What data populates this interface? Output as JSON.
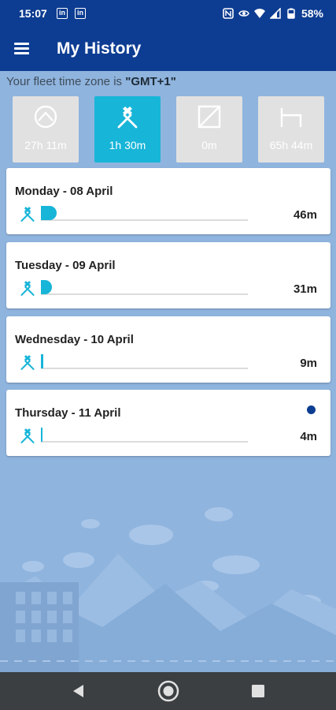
{
  "status_bar": {
    "time": "15:07",
    "left_icons": [
      "in",
      "in"
    ],
    "battery": "58%",
    "icons": [
      "nfc-icon",
      "eye-icon",
      "wifi-icon",
      "signal-icon",
      "battery-icon"
    ]
  },
  "app_bar": {
    "title": "My History",
    "menu_icon": "menu-icon"
  },
  "timezone": {
    "prefix": "Your fleet time zone is ",
    "value": "\"GMT+1\""
  },
  "summary": [
    {
      "icon": "steering-wheel-icon",
      "value": "27h 11m",
      "active": false
    },
    {
      "icon": "work-tools-icon",
      "value": "1h 30m",
      "active": true
    },
    {
      "icon": "availability-icon",
      "value": "0m",
      "active": false
    },
    {
      "icon": "bed-rest-icon",
      "value": "65h 44m",
      "active": false
    }
  ],
  "days": [
    {
      "title": "Monday - 08 April",
      "total": "46m",
      "fraction": 0.077,
      "current": false
    },
    {
      "title": "Tuesday - 09 April",
      "total": "31m",
      "fraction": 0.052,
      "current": false
    },
    {
      "title": "Wednesday - 10 April",
      "total": "9m",
      "fraction": 0.012,
      "current": false
    },
    {
      "title": "Thursday - 11 April",
      "total": "4m",
      "fraction": 0.006,
      "current": true
    }
  ],
  "colors": {
    "primary": "#0d3d92",
    "accent": "#17b5d8",
    "background": "#8fb4de",
    "inactive_tile": "#e1e1e1"
  },
  "nav": {
    "back_icon": "back-triangle-icon",
    "home_icon": "home-circle-icon",
    "recents_icon": "recents-square-icon"
  }
}
